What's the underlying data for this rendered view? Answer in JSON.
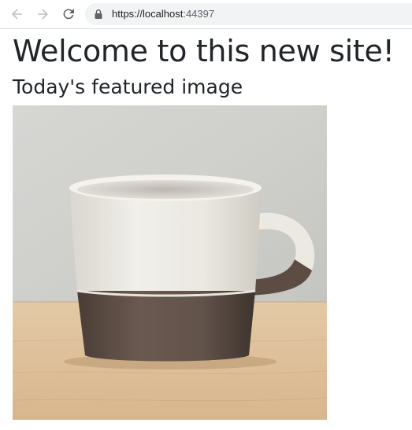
{
  "browser": {
    "url_scheme": "https://",
    "url_host": "localhost",
    "url_port": ":44397"
  },
  "page": {
    "title": "Welcome to this new site!",
    "subtitle": "Today's featured image",
    "image_subject": "ceramic mug with white glaze and dark brown base on wooden table"
  },
  "icons": {
    "back": "arrow-left-icon",
    "forward": "arrow-right-icon",
    "reload": "reload-icon",
    "lock": "lock-icon"
  },
  "colors": {
    "toolbar_bg": "#ffffff",
    "omnibox_bg": "#f1f3f4",
    "text": "#212529",
    "icon": "#5f6368"
  }
}
